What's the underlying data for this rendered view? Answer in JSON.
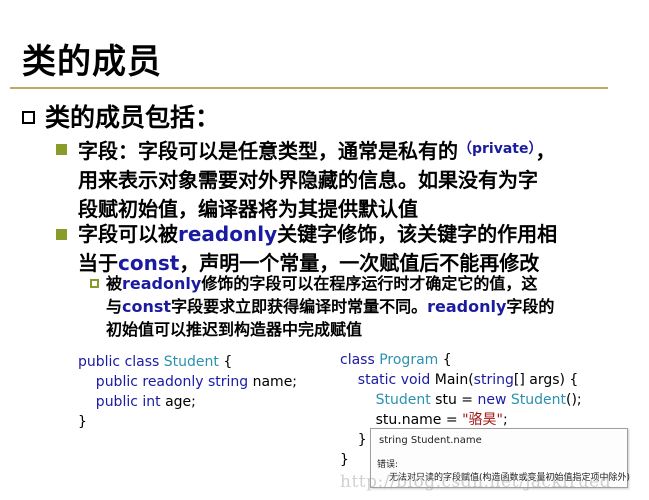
{
  "slide": {
    "title": "类的成员",
    "bullet1": "类的成员包括：",
    "field_a_pre": "字段：字段可以是任意类型，通常是私有的",
    "field_a_paren": "（private）",
    "field_a_post": "，",
    "field_a_line2": "用来表示对象需要对外界隐藏的信息。如果没有为字",
    "field_a_line3": "段赋初始值，编译器将为其提供默认值",
    "field_b_pre": "字段可以被",
    "field_b_kw": "readonly",
    "field_b_post": "关键字修饰，该关键字的作用相",
    "field_b_line2_pre": "当于",
    "field_b_line2_kw": "const",
    "field_b_line2_post": "，声明一个常量，一次赋值后不能再修改",
    "sub_pre": "被",
    "sub_kw1": "readonly",
    "sub_mid1": "修饰的字段可以在程序运行时才确定它的值，这",
    "sub_line2_pre": "与",
    "sub_kw2": "const",
    "sub_mid2": "字段要求立即获得编译时常量不同。",
    "sub_kw3": "readonly",
    "sub_post": "字段的",
    "sub_line3": "初始值可以推迟到构造器中完成赋值"
  },
  "code_left": {
    "l1_k": "public class ",
    "l1_t": "Student",
    "l1_r": " {",
    "l2_k": "    public readonly string",
    "l2_r": " name;",
    "l3_k": "    public int",
    "l3_r": " age;",
    "l4": "}"
  },
  "code_right": {
    "l1_k": "class ",
    "l1_t": "Program",
    "l1_r": " {",
    "l2_k": "    static void",
    "l2_r": " Main(",
    "l2_k2": "string",
    "l2_r2": "[] args) {",
    "l3_t": "        Student",
    "l3_r": " stu = ",
    "l3_k": "new ",
    "l3_t2": "Student",
    "l3_r2": "();",
    "l4_pre": "        stu.",
    "l4_sq": "name",
    "l4_r": " = ",
    "l4_s": "\"骆昊\"",
    "l4_end": ";",
    "l5": "    }",
    "l6": "}"
  },
  "tooltip": {
    "signature": "string Student.name",
    "error_label": "错误:",
    "error_msg": "无法对只读的字段赋值(构造函数或变量初始值指定项中除外)"
  },
  "watermark": "http://blog.csdn.net/jackfrued",
  "colors": {
    "rule": "#c0a95c",
    "bullet": "#8a9a2b",
    "keyword": "#1b1ba0",
    "type": "#2b91af",
    "string": "#a31515"
  }
}
